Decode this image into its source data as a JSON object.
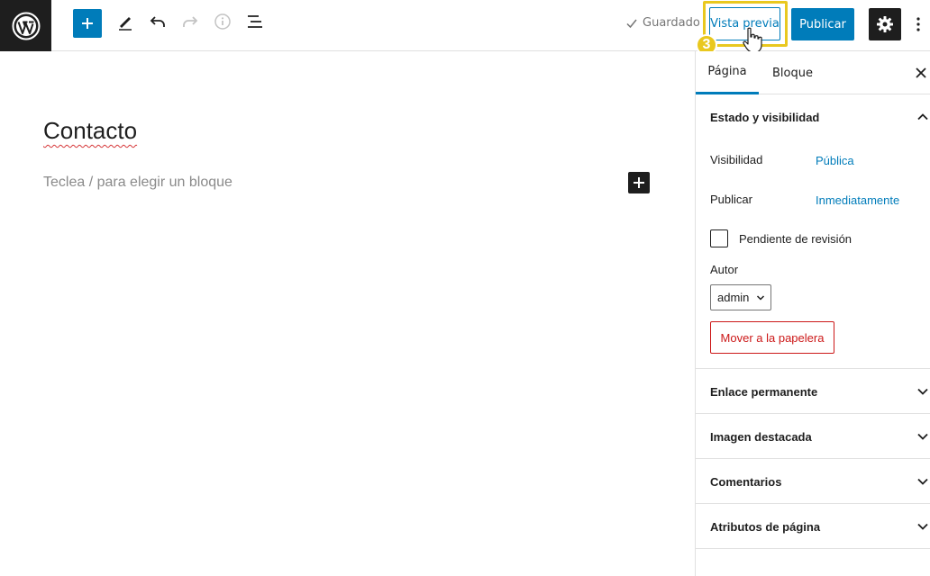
{
  "toolbar": {
    "saved_label": "Guardado",
    "preview_label": "Vista previa",
    "publish_label": "Publicar",
    "step_number": "3"
  },
  "editor": {
    "title": "Contacto",
    "block_placeholder": "Teclea / para elegir un bloque"
  },
  "sidebar": {
    "tabs": [
      {
        "label": "Página",
        "active": true
      },
      {
        "label": "Bloque",
        "active": false
      }
    ],
    "status_panel": {
      "title": "Estado y visibilidad",
      "visibility_label": "Visibilidad",
      "visibility_value": "Pública",
      "publish_label": "Publicar",
      "publish_value": "Inmediatamente",
      "pending_review_label": "Pendiente de revisión",
      "author_label": "Autor",
      "author_value": "admin",
      "trash_label": "Mover a la papelera"
    },
    "panels": [
      {
        "title": "Enlace permanente"
      },
      {
        "title": "Imagen destacada"
      },
      {
        "title": "Comentarios"
      },
      {
        "title": "Atributos de página"
      }
    ]
  },
  "colors": {
    "accent": "#007cba",
    "highlight": "#e9c81f",
    "danger": "#cc1818",
    "dark": "#1e1e1e"
  },
  "icons": [
    "wordpress-logo-icon",
    "plus-icon",
    "pencil-icon",
    "undo-icon",
    "redo-icon",
    "info-icon",
    "list-view-icon",
    "check-icon",
    "pointer-hand-icon",
    "gear-icon",
    "more-vertical-icon",
    "close-icon",
    "chevron-up-icon",
    "chevron-down-icon"
  ]
}
